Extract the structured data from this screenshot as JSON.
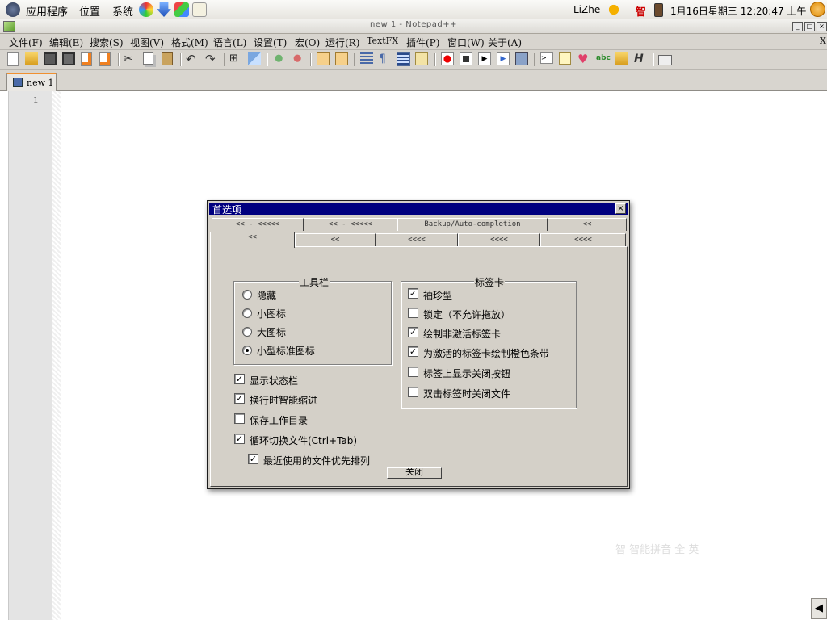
{
  "panel": {
    "menus": [
      "应用程序",
      "位置",
      "系统"
    ],
    "user": "LiZhe",
    "ime_indicator": "智",
    "clock": "1月16日星期三 12:20:47 上午"
  },
  "window": {
    "title": "new 1 - Notepad++"
  },
  "menubar": {
    "items": [
      "文件(F)",
      "编辑(E)",
      "搜索(S)",
      "视图(V)",
      "格式(M)",
      "语言(L)",
      "设置(T)",
      "宏(O)",
      "运行(R)",
      "TextFX",
      "插件(P)",
      "窗口(W)",
      "关于(A)"
    ],
    "close_x": "X"
  },
  "doc_tab": {
    "label": "new 1"
  },
  "editor": {
    "line_number": "1"
  },
  "ime_bar": {
    "text": "智 智能拼音 全 英"
  },
  "dialog": {
    "title": "首选项",
    "tabs_row1": [
      "<< - <<<<<",
      "<< - <<<<<",
      "Backup/Auto-completion",
      "<<"
    ],
    "tabs_row2": [
      "<<",
      "<<",
      "<<<<",
      "<<<<",
      "<<<<"
    ],
    "toolbar_group": {
      "label": "工具栏",
      "options": [
        {
          "label": "隐藏",
          "selected": false
        },
        {
          "label": "小图标",
          "selected": false
        },
        {
          "label": "大图标",
          "selected": false
        },
        {
          "label": "小型标准图标",
          "selected": true
        }
      ]
    },
    "tab_group": {
      "label": "标签卡",
      "options": [
        {
          "label": "袖珍型",
          "checked": true
        },
        {
          "label": "锁定（不允许拖放）",
          "checked": false
        },
        {
          "label": "绘制非激活标签卡",
          "checked": true
        },
        {
          "label": "为激活的标签卡绘制橙色条带",
          "checked": true
        },
        {
          "label": "标签上显示关闭按钮",
          "checked": false
        },
        {
          "label": "双击标签时关闭文件",
          "checked": false
        }
      ]
    },
    "misc_options": [
      {
        "label": "显示状态栏",
        "checked": true
      },
      {
        "label": "换行时智能缩进",
        "checked": true
      },
      {
        "label": "保存工作目录",
        "checked": false
      },
      {
        "label": "循环切换文件(Ctrl+Tab)",
        "checked": true
      },
      {
        "label": "最近使用的文件优先排列",
        "checked": true
      }
    ],
    "close_button": "关闭"
  }
}
